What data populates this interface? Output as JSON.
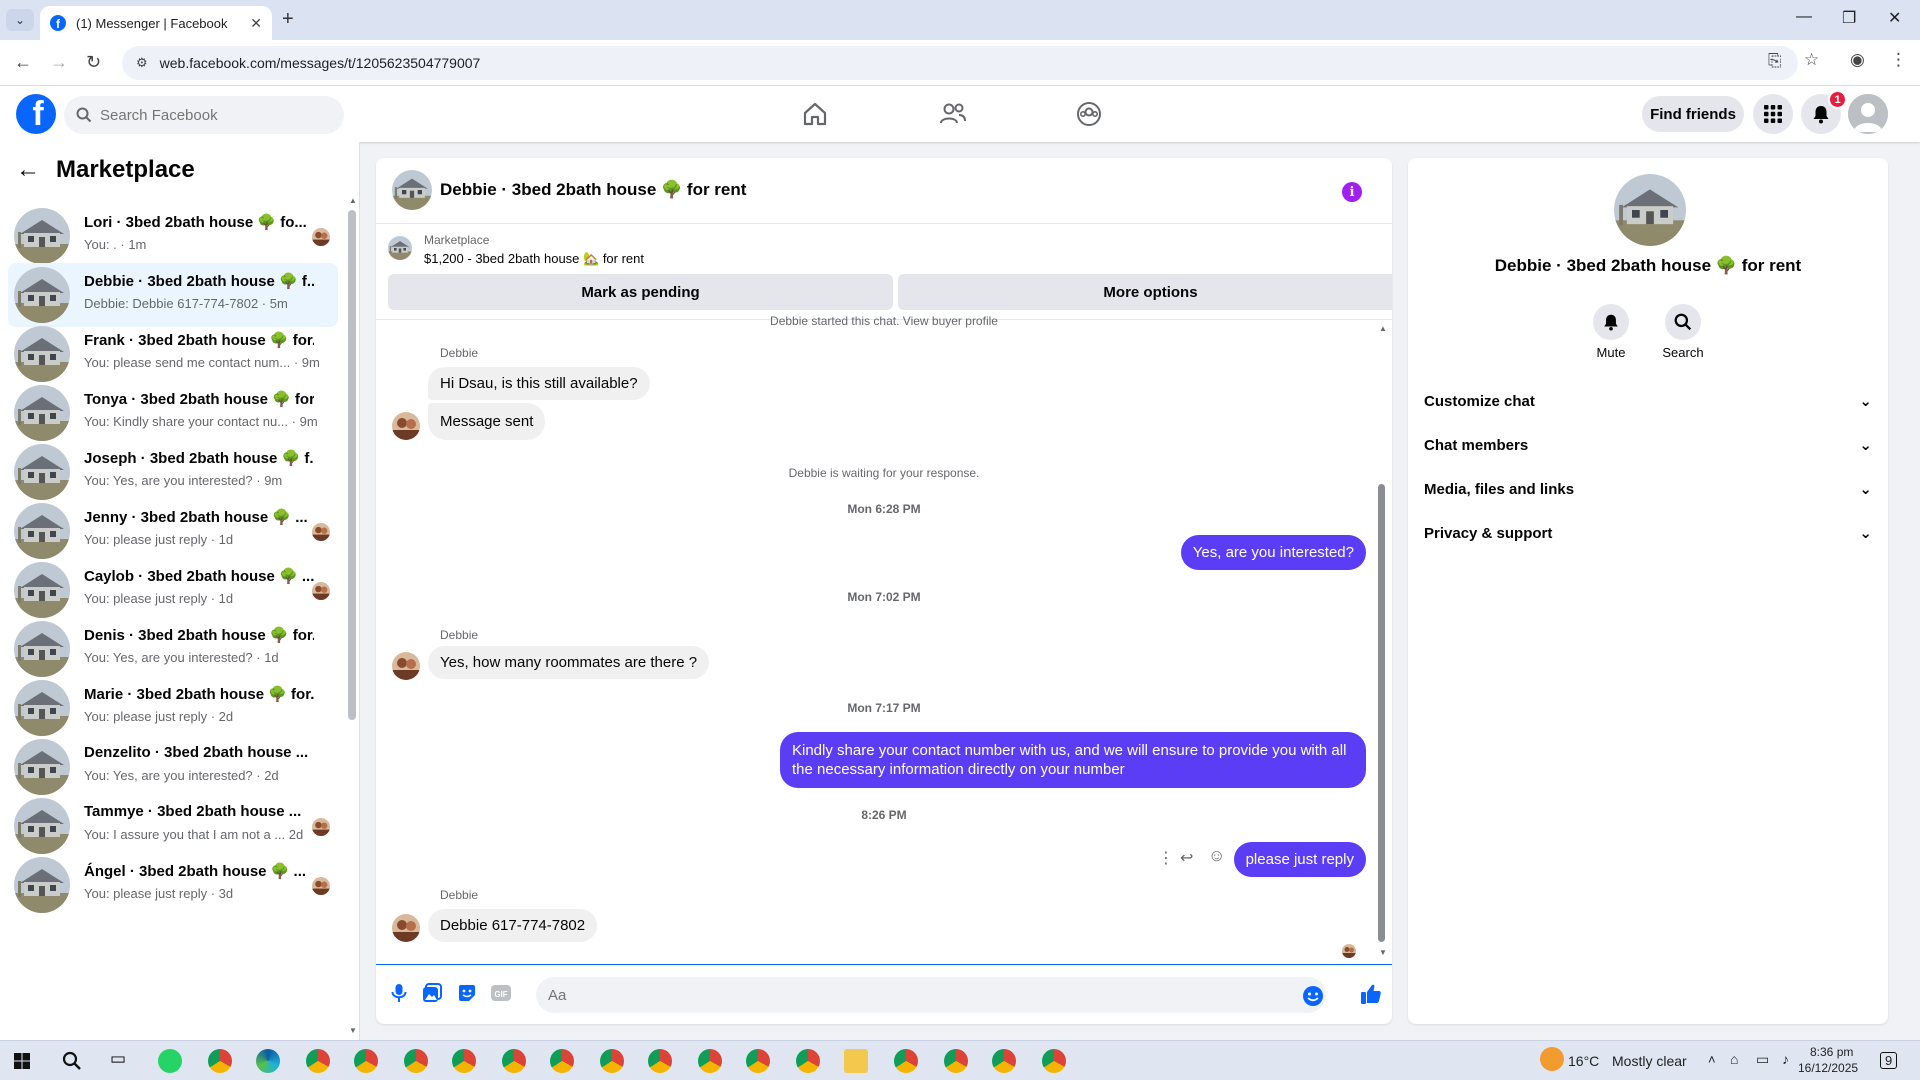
{
  "browser": {
    "tab_title": "(1) Messenger | Facebook",
    "url": "web.facebook.com/messages/t/1205623504779007"
  },
  "header": {
    "search_placeholder": "Search Facebook",
    "find_friends": "Find friends",
    "notification_count": "1"
  },
  "sidebar": {
    "title": "Marketplace",
    "conversations": [
      {
        "name": "Lori · 3bed 2bath house 🌳 fo...",
        "preview": "You: . · 1m",
        "mini_avatar": true
      },
      {
        "name": "Debbie · 3bed 2bath house 🌳 f...",
        "preview": "Debbie: Debbie 617-774-7802 · 5m",
        "active": true
      },
      {
        "name": "Frank · 3bed 2bath house 🌳 for...",
        "preview": "You: please send me contact num... · 9m"
      },
      {
        "name": "Tonya · 3bed 2bath house 🌳 for...",
        "preview": "You: Kindly share your contact nu... · 9m"
      },
      {
        "name": "Joseph · 3bed 2bath house 🌳 f...",
        "preview": "You: Yes, are you interested? · 9m"
      },
      {
        "name": "Jenny · 3bed 2bath house 🌳 ...",
        "preview": "You: please just reply · 1d",
        "mini_avatar": true
      },
      {
        "name": "Caylob · 3bed 2bath house 🌳 ...",
        "preview": "You: please just reply · 1d",
        "mini_avatar": true
      },
      {
        "name": "Denis · 3bed 2bath house 🌳 for...",
        "preview": "You: Yes, are you interested? · 1d"
      },
      {
        "name": "Marie · 3bed 2bath house 🌳 for...",
        "preview": "You: please just reply · 2d"
      },
      {
        "name": "Denzelito · 3bed 2bath house ...",
        "preview": "You: Yes, are you interested? · 2d"
      },
      {
        "name": "Tammye · 3bed 2bath house ...",
        "preview": "You: I assure you that I am not a ... 2d",
        "mini_avatar": true
      },
      {
        "name": "Ángel · 3bed 2bath house 🌳 ...",
        "preview": "You: please just reply · 3d",
        "mini_avatar": true
      }
    ]
  },
  "chat": {
    "title": "Debbie · 3bed 2bath house 🌳 for rent",
    "marketplace_label": "Marketplace",
    "item_line": "$1,200 - 3bed 2bath house 🏡 for rent",
    "mark_pending": "Mark as pending",
    "more_options": "More options",
    "started_note": "Debbie started this chat. View buyer profile",
    "sender": "Debbie",
    "msg1": "Hi Dsau, is this still available?",
    "msg2": "Message sent",
    "waiting_note": "Debbie is waiting for your response.",
    "time1": "Mon 6:28 PM",
    "out1": "Yes, are you interested?",
    "time2": "Mon 7:02 PM",
    "msg3": "Yes, how many roommates are there ?",
    "time3": "Mon 7:17 PM",
    "out2": "Kindly share your contact number with us, and we will ensure to provide you with all the necessary information directly on your number",
    "time4": "8:26 PM",
    "out3": "please just reply",
    "msg4": "Debbie 617-774-7802",
    "composer_placeholder": "Aa"
  },
  "right_panel": {
    "name": "Debbie · 3bed 2bath house 🌳 for rent",
    "mute": "Mute",
    "search": "Search",
    "rows": [
      "Customize chat",
      "Chat members",
      "Media, files and links",
      "Privacy & support"
    ]
  },
  "taskbar": {
    "temperature": "16°C",
    "weather": "Mostly clear",
    "time": "8:36 pm",
    "date": "16/12/2025",
    "notif": "9"
  },
  "colors": {
    "fb_blue": "#0866ff",
    "outgoing_bubble": "#5b3df5",
    "info_purple": "#a020f0"
  }
}
